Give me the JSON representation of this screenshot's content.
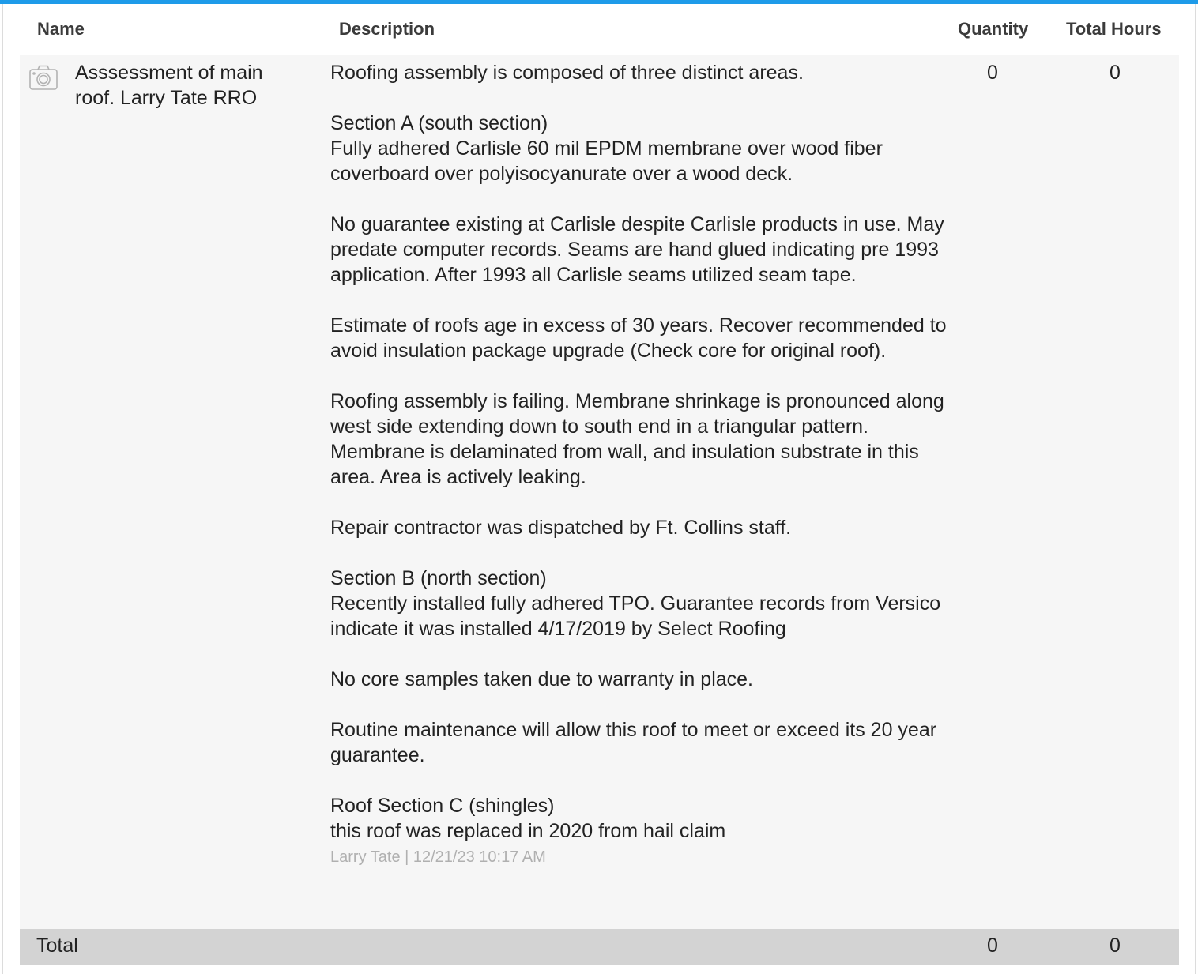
{
  "table": {
    "headers": {
      "name": "Name",
      "description": "Description",
      "quantity": "Quantity",
      "total_hours": "Total Hours"
    },
    "rows": [
      {
        "icon": "camera-icon",
        "name": "Asssessment of main roof. Larry Tate RRO",
        "description_paragraphs": [
          "Roofing assembly is composed of three distinct areas.",
          "Section A (south section)\nFully adhered Carlisle 60 mil EPDM membrane over wood fiber coverboard over polyisocyanurate over a wood deck.",
          "No guarantee existing at Carlisle despite Carlisle products in use. May predate computer records. Seams are hand glued indicating pre 1993 application. After 1993 all Carlisle seams utilized seam tape.",
          "Estimate of roofs age in excess of 30 years. Recover recommended to avoid insulation package upgrade (Check core for original roof).",
          "Roofing assembly is failing. Membrane shrinkage is pronounced along west side extending down to south end in a triangular pattern. Membrane is delaminated from wall, and insulation substrate in this area. Area is actively leaking.",
          "Repair contractor was dispatched by Ft. Collins staff.",
          "Section B (north section)\nRecently installed fully adhered TPO. Guarantee records from Versico indicate it was installed 4/17/2019 by Select Roofing",
          "No core samples taken due to warranty in place.",
          "Routine maintenance will allow this roof to meet or exceed its 20 year guarantee.",
          "Roof Section C (shingles)\nthis roof was replaced in 2020 from hail claim"
        ],
        "meta": "Larry Tate | 12/21/23 10:17 AM",
        "quantity": "0",
        "total_hours": "0"
      }
    ],
    "total": {
      "label": "Total",
      "quantity": "0",
      "total_hours": "0"
    }
  },
  "colors": {
    "accent": "#1e9be9",
    "row_background": "#f6f6f6",
    "total_background": "#d3d3d3"
  }
}
